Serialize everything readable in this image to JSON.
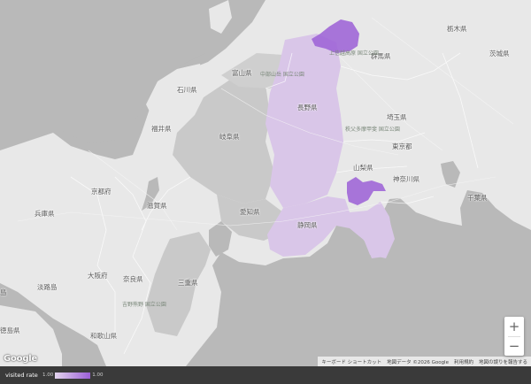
{
  "map": {
    "prefectures": [
      {
        "key": "tochigi",
        "label": "栃木県"
      },
      {
        "key": "ibaraki",
        "label": "茨城県"
      },
      {
        "key": "gunma",
        "label": "群馬県"
      },
      {
        "key": "toyama",
        "label": "富山県"
      },
      {
        "key": "ishikawa",
        "label": "石川県"
      },
      {
        "key": "fukui",
        "label": "福井県"
      },
      {
        "key": "gifu",
        "label": "岐阜県"
      },
      {
        "key": "nagano",
        "label": "長野県"
      },
      {
        "key": "saitama",
        "label": "埼玉県"
      },
      {
        "key": "tokyo",
        "label": "東京都"
      },
      {
        "key": "yamanashi",
        "label": "山梨県"
      },
      {
        "key": "kanagawa",
        "label": "神奈川県"
      },
      {
        "key": "chiba",
        "label": "千葉県"
      },
      {
        "key": "kyoto",
        "label": "京都府"
      },
      {
        "key": "shiga",
        "label": "滋賀県"
      },
      {
        "key": "hyogo",
        "label": "兵庫県"
      },
      {
        "key": "aichi",
        "label": "愛知県"
      },
      {
        "key": "shizuoka",
        "label": "静岡県"
      },
      {
        "key": "osaka",
        "label": "大阪府"
      },
      {
        "key": "nara",
        "label": "奈良県"
      },
      {
        "key": "mie",
        "label": "三重県"
      },
      {
        "key": "wakayama",
        "label": "和歌山県"
      },
      {
        "key": "tokushima",
        "label": "徳島県"
      },
      {
        "key": "awaji",
        "label": "淡路島"
      },
      {
        "key": "shima",
        "label": "島"
      }
    ],
    "parks": [
      {
        "key": "joshinetsu",
        "label": "上信越高原 国立公園"
      },
      {
        "key": "chubu",
        "label": "中部山岳 国立公園"
      },
      {
        "key": "chichibu",
        "label": "秩父多摩甲斐 国立公園"
      },
      {
        "key": "yoshino",
        "label": "吉野熊野 国立公園"
      }
    ],
    "google_logo": "Google",
    "attribution": {
      "shortcuts": "キーボード ショートカット",
      "data": "地図データ ©2026 Google",
      "terms": "利用規約",
      "report": "地図の誤りを報告する"
    },
    "zoom": {
      "in": "+",
      "out": "−"
    }
  },
  "legend": {
    "title": "visited rate",
    "min": "1.00",
    "max": "1.00",
    "colors": {
      "low": "#e3d4ee",
      "high": "#9b5fd6"
    }
  },
  "colors": {
    "visited_strong": "#9b5fd6",
    "visited_light": "#d9c6e8",
    "land": "#e8e8e8",
    "sea": "#b9b9b9",
    "region_gray": "#c9c9c9"
  }
}
